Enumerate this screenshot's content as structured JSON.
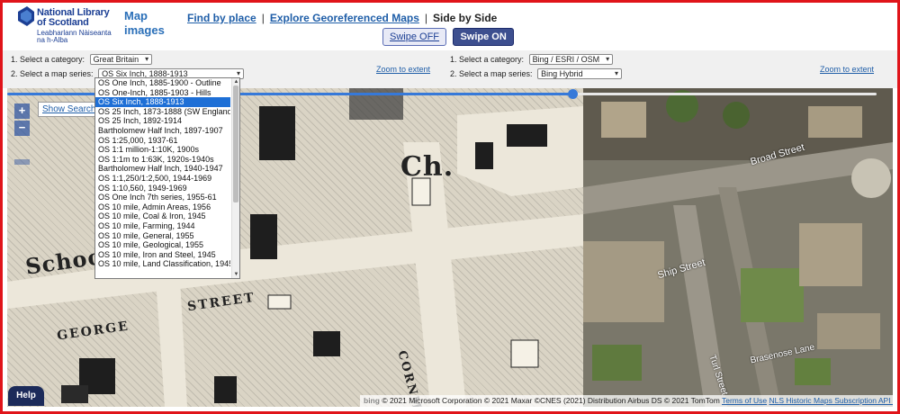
{
  "header": {
    "logo_line1": "National Library",
    "logo_line2": "of Scotland",
    "logo_sub1": "Leabharlann Nàiseanta",
    "logo_sub2": "na h-Alba",
    "app_title_line1": "Map",
    "app_title_line2": "images",
    "nav": {
      "find_by_place": "Find by place",
      "explore": "Explore Georeferenced Maps",
      "current": "Side by Side",
      "separator": "|"
    },
    "swipe_off": "Swipe OFF",
    "swipe_on": "Swipe ON"
  },
  "left_controls": {
    "category_label": "1. Select a category:",
    "category_value": "Great Britain",
    "series_label": "2. Select a map series:",
    "series_value": "OS Six Inch, 1888-1913",
    "zoom_link": "Zoom to extent"
  },
  "right_controls": {
    "category_label": "1. Select a category:",
    "category_value": "Bing / ESRI / OSM",
    "series_label": "2. Select a map series:",
    "series_value": "Bing Hybrid",
    "zoom_link": "Zoom to extent"
  },
  "dropdown_options": [
    "OS One Inch, 1885-1900 - Outline",
    "OS One-Inch, 1885-1903 - Hills",
    "OS Six Inch, 1888-1913",
    "OS 25 Inch, 1873-1888 (SW England)",
    "OS 25 Inch, 1892-1914",
    "Bartholomew Half Inch, 1897-1907",
    "OS 1:25,000, 1937-61",
    "OS 1:1 million-1:10K, 1900s",
    "OS 1:1m to 1:63K, 1920s-1940s",
    "Bartholomew Half Inch, 1940-1947",
    "OS 1:1,250/1:2,500, 1944-1969",
    "OS 1:10,560, 1949-1969",
    "OS One Inch 7th series, 1955-61",
    "OS 10 mile, Admin Areas, 1956",
    "OS 10 mile, Coal & Iron, 1945",
    "OS 10 mile, Farming, 1944",
    "OS 10 mile, General, 1955",
    "OS 10 mile, Geological, 1955",
    "OS 10 mile, Iron and Steel, 1945",
    "OS 10 mile, Land Classification, 1945"
  ],
  "selected_option_index": 2,
  "swipe_position_fraction": 0.65,
  "map_controls": {
    "zoom_in": "+",
    "zoom_out": "−",
    "show_search": "Show Search"
  },
  "left_map_labels": {
    "ch": "Ch.",
    "school": "Schoo",
    "street": "STREET",
    "george": "GEORGE",
    "cornmarket": "CORNMA"
  },
  "right_map_labels": {
    "broad_street": "Broad Street",
    "ship_street": "Ship Street",
    "turl_street": "Turl Street",
    "brasenose_lane": "Brasenose Lane"
  },
  "help_label": "Help",
  "attribution": {
    "bing": "bing",
    "text": "© 2021 Microsoft Corporation © 2021 Maxar ©CNES (2021) Distribution Airbus DS © 2021 TomTom",
    "terms_link": "Terms of Use",
    "nls_link": "NLS Historic Maps Subscription API layer"
  },
  "colors": {
    "frame": "#e0141a",
    "brand_blue": "#1c3f94",
    "link_blue": "#1f5ea8",
    "slider_blue": "#3679d9",
    "selected_option": "#1e6fd6"
  }
}
